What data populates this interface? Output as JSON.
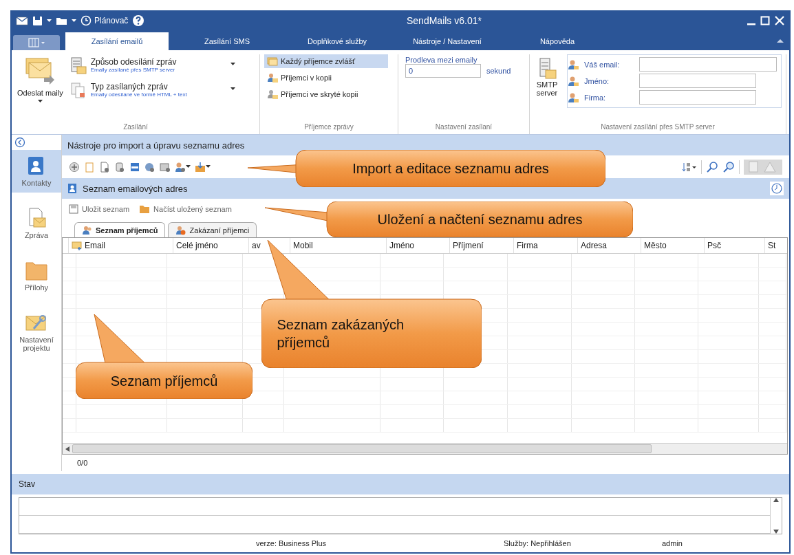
{
  "quick_access": {
    "scheduler_label": "Plánovač"
  },
  "window": {
    "title": "SendMails v6.01*"
  },
  "tabs": [
    {
      "label": "Zasílání emailů",
      "selected": true
    },
    {
      "label": "Zasílání SMS",
      "selected": false
    },
    {
      "label": "Doplňkové služby",
      "selected": false
    },
    {
      "label": "Nástroje / Nastavení",
      "selected": false
    },
    {
      "label": "Nápověda",
      "selected": false
    }
  ],
  "ribbon": {
    "send": {
      "label": "Odeslat maily",
      "group_label": "Zasílání",
      "options": [
        {
          "title": "Způsob odesílání zpráv",
          "subtitle": "Emaily zasílané přes SMTP server"
        },
        {
          "title": "Typ zasílaných zpráv",
          "subtitle": "Emaily odesílané ve formě HTML + text"
        }
      ]
    },
    "recipients": {
      "group_label": "Příjemce zprávy",
      "items": [
        {
          "label": "Každý příjemce zvlášť",
          "selected": true
        },
        {
          "label": "Příjemci v kopii",
          "selected": false
        },
        {
          "label": "Příjemci ve skryté kopii",
          "selected": false
        }
      ]
    },
    "delay": {
      "group_label": "Nastavení zasílaní",
      "label": "Prodleva mezi emaily",
      "value": "0",
      "unit": "sekund"
    },
    "smtp": {
      "group_label": "Nastavení zasílání přes SMTP server",
      "button": "SMTP server",
      "fields": [
        {
          "label": "Váš email:"
        },
        {
          "label": "Jméno:"
        },
        {
          "label": "Firma:"
        }
      ]
    }
  },
  "sidebar": {
    "items": [
      {
        "label": "Kontakty",
        "kind": "contacts",
        "selected": true
      },
      {
        "label": "Zpráva",
        "kind": "message",
        "selected": false
      },
      {
        "label": "Přílohy",
        "kind": "attachments",
        "selected": false
      },
      {
        "label": "Nastavení projektu",
        "kind": "settings",
        "selected": false
      }
    ]
  },
  "tools_panel": {
    "title": "Nástroje pro import a úpravu seznamu adres"
  },
  "list_panel": {
    "title": "Seznam emailových adres",
    "actions": [
      {
        "label": "Uložit seznam"
      },
      {
        "label": "Načíst uložený seznam"
      }
    ],
    "subtabs": [
      {
        "label": "Seznam příjemců",
        "selected": true
      },
      {
        "label": "Zakázaní příjemci",
        "selected": false
      }
    ]
  },
  "table": {
    "columns": [
      "Email",
      "Celé jméno",
      "av",
      "Mobil",
      "Jméno",
      "Příjmení",
      "Firma",
      "Adresa",
      "Město",
      "Psč",
      "St"
    ]
  },
  "counter": "0/0",
  "status_panel": {
    "title": "Stav"
  },
  "status_bar": [
    "verze: Business Plus",
    "Služby: Nepřihlášen",
    "admin"
  ],
  "callouts": [
    {
      "text": "Import a editace seznamu adres"
    },
    {
      "text": "Uložení a načtení seznamu adres"
    },
    {
      "text": "Seznam zakázaných příjemců"
    },
    {
      "text": "Seznam příjemců"
    }
  ]
}
